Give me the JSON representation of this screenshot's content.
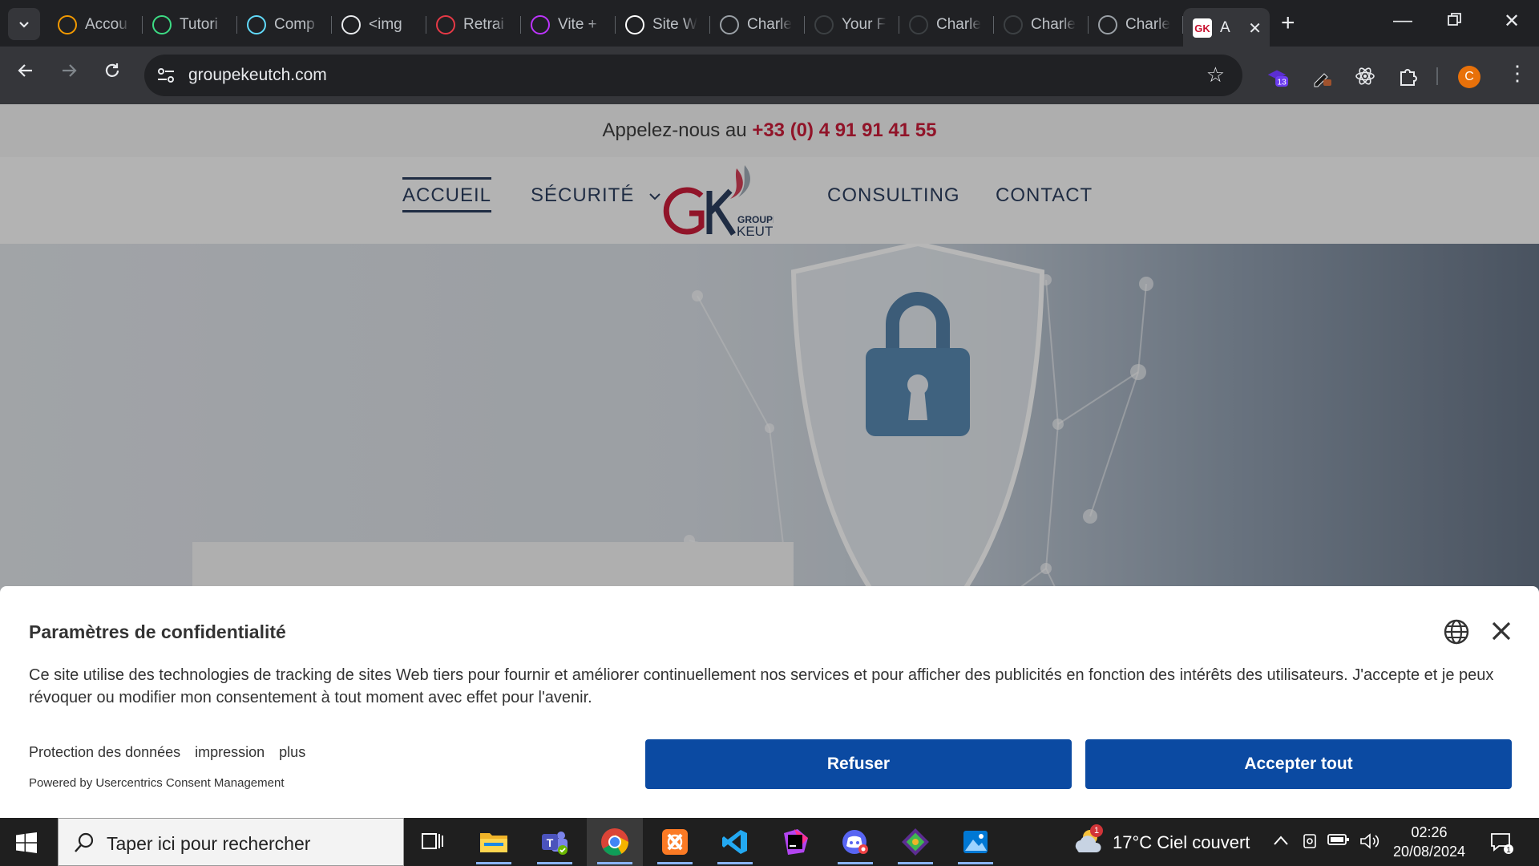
{
  "browser": {
    "tabs": [
      {
        "label": "Accou",
        "icon": "bolt-favicon",
        "color": "#f29900"
      },
      {
        "label": "Tutori",
        "icon": "w-favicon",
        "color": "#3ddc84"
      },
      {
        "label": "Comp",
        "icon": "react-favicon",
        "color": "#61dafb"
      },
      {
        "label": "<img",
        "icon": "m-favicon",
        "color": "#e8eaed"
      },
      {
        "label": "Retrai",
        "icon": "retraite-favicon",
        "color": "#e63946"
      },
      {
        "label": "Vite +",
        "icon": "vite-favicon",
        "color": "#bd34fe"
      },
      {
        "label": "Site W",
        "icon": "openai-favicon",
        "color": "#ffffff"
      },
      {
        "label": "Charle",
        "icon": "globe-favicon",
        "color": "#9aa0a6"
      },
      {
        "label": "Your F",
        "icon": "github-favicon",
        "color": "#3c4043"
      },
      {
        "label": "Charle",
        "icon": "github-favicon",
        "color": "#3c4043"
      },
      {
        "label": "Charle",
        "icon": "github-favicon",
        "color": "#3c4043"
      },
      {
        "label": "Charle",
        "icon": "globe-favicon",
        "color": "#9aa0a6"
      }
    ],
    "active_tab": {
      "label": "A",
      "icon": "gk-favicon"
    },
    "url": "groupekeutch.com",
    "extension_badge": "13",
    "profile_initial": "C"
  },
  "site": {
    "topbar_prefix": "Appelez-nous au",
    "phone": "+33 (0) 4 91 91 41 55",
    "nav": {
      "accueil": "ACCUEIL",
      "securite": "SÉCURITÉ",
      "consulting": "CONSULTING",
      "contact": "CONTACT"
    },
    "logo": {
      "mark": "GK",
      "line1": "GROUPE",
      "line2": "KEUTCH"
    },
    "colors": {
      "brand_red": "#c8102e",
      "brand_navy": "#1f3355"
    }
  },
  "consent": {
    "title": "Paramètres de confidentialité",
    "body": "Ce site utilise des technologies de tracking de sites Web tiers pour fournir et améliorer continuellement nos services et pour afficher des publicités en fonction des intérêts des utilisateurs. J'accepte et je peux révoquer ou modifier mon consentement à tout moment avec effet pour l'avenir.",
    "links": [
      "Protection des données",
      "impression",
      "plus"
    ],
    "powered_by": "Powered by Usercentrics Consent Management",
    "refuse_label": "Refuser",
    "accept_label": "Accepter tout",
    "button_color": "#0b4aa2"
  },
  "taskbar": {
    "search_placeholder": "Taper ici pour rechercher",
    "weather_badge": "1",
    "weather": "17°C  Ciel couvert",
    "time": "02:26",
    "date": "20/08/2024",
    "notification_count": "1"
  }
}
